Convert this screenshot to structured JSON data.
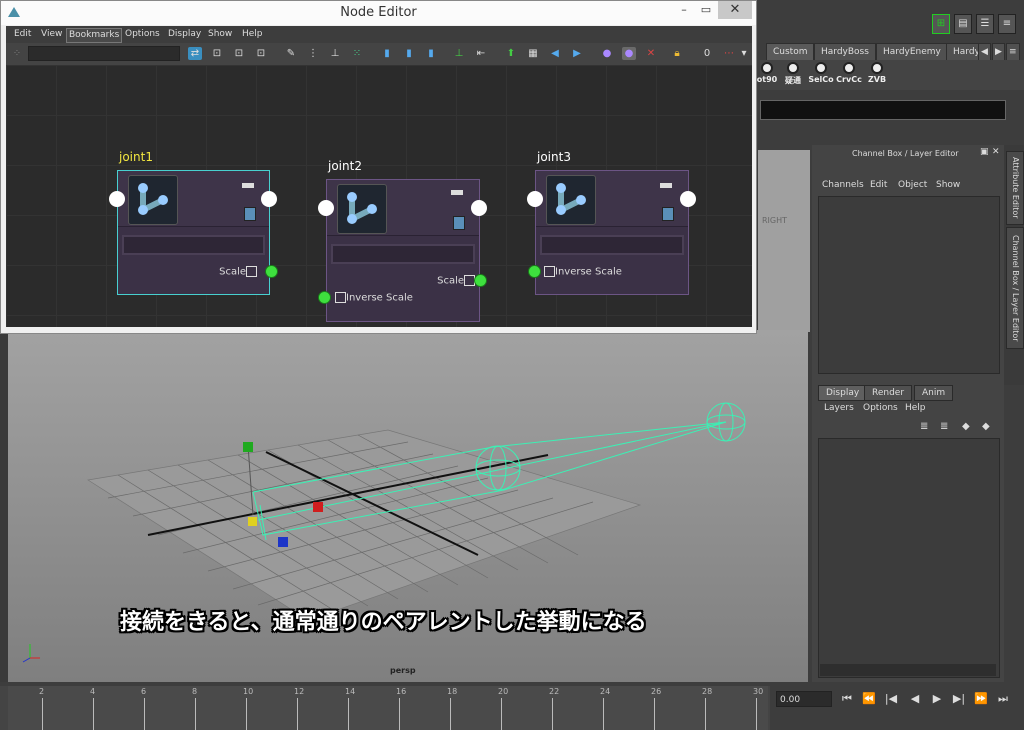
{
  "node_editor": {
    "title": "Node Editor",
    "menus": [
      "Edit",
      "View",
      "Bookmarks",
      "Options",
      "Display",
      "Show",
      "Help"
    ],
    "active_menu": "Bookmarks",
    "nodes": [
      {
        "name": "joint1",
        "output_attr": "Scale",
        "input_attr": "",
        "selected": true,
        "label_color": "#f2e640"
      },
      {
        "name": "joint2",
        "output_attr": "Scale",
        "input_attr": "Inverse Scale",
        "selected": false,
        "label_color": "#ffffff"
      },
      {
        "name": "joint3",
        "output_attr": "",
        "input_attr": "Inverse Scale",
        "selected": false,
        "label_color": "#ffffff"
      }
    ]
  },
  "shelf": {
    "tabs": [
      "Custom",
      "HardyBoss",
      "HardyEnemy",
      "Hardy"
    ],
    "active_tab": "Custom",
    "icons": [
      "ot90",
      "疑通",
      "SelCo",
      "CrvCc",
      "ZVB"
    ]
  },
  "channel_box": {
    "title": "Channel Box / Layer Editor",
    "menus": [
      "Channels",
      "Edit",
      "Object",
      "Show"
    ],
    "side_tabs": [
      "Attribute Editor",
      "Channel Box / Layer Editor"
    ]
  },
  "layer_editor": {
    "tabs": [
      "Display",
      "Render",
      "Anim"
    ],
    "active_tab": "Display",
    "menus": [
      "Layers",
      "Options",
      "Help"
    ]
  },
  "viewport": {
    "camera_label": "persp",
    "view_cube_label": "RIGHT",
    "subtitle": "接続をきると、通常通りのペアレントした挙動になる"
  },
  "timeline": {
    "ticks": [
      "2",
      "4",
      "6",
      "8",
      "10",
      "12",
      "14",
      "16",
      "18",
      "20",
      "22",
      "24",
      "26",
      "28",
      "30"
    ],
    "current_time": "0.00"
  },
  "colors": {
    "selected_outline": "#48d0d0",
    "node_body": "#3b3146",
    "port_connected": "#3ee03e"
  }
}
